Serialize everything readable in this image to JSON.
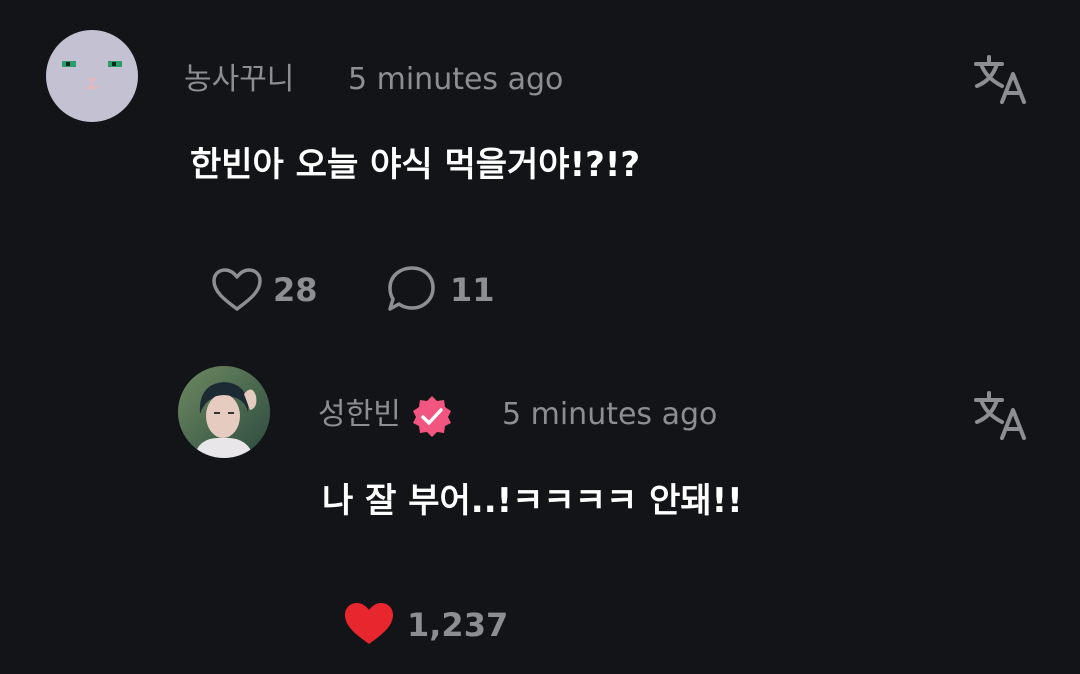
{
  "comments": [
    {
      "author": "농사꾸니",
      "time": "5 minutes ago",
      "text": "한빈아 오늘 야식 먹을거야!?!?",
      "likes": "28",
      "replies": "11"
    },
    {
      "author": "성한빈",
      "verified": true,
      "time": "5 minutes ago",
      "text": "나 잘 부어..!ㅋㅋㅋㅋ 안돼!!",
      "likes": "1,237",
      "liked": true
    }
  ],
  "icons": {
    "translate": "translate-icon",
    "heart": "heart-outline-icon",
    "heart_filled": "heart-filled-icon",
    "comment": "comment-bubble-icon",
    "verified": "verified-badge-icon"
  },
  "colors": {
    "background": "#131417",
    "muted_text": "#8d8e94",
    "verified_badge": "#f2557f",
    "liked_heart": "#e8262d"
  }
}
